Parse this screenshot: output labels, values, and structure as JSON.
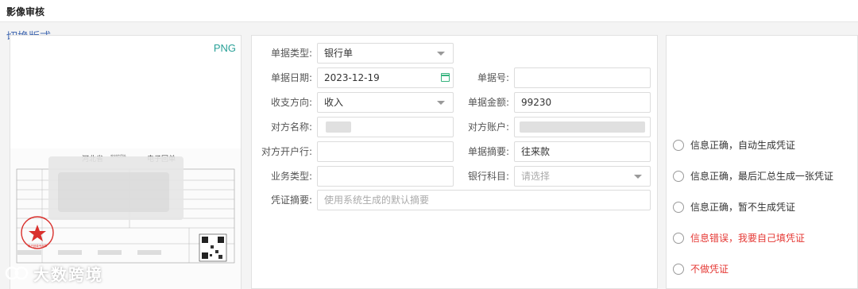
{
  "header": {
    "title": "影像审核"
  },
  "switch_label": "切换版式",
  "image_panel": {
    "format": "PNG",
    "receipt": {
      "province": "河北省",
      "bank_small": "农村信用社",
      "title": "电子回单",
      "seal_text": "电子回单专用章"
    }
  },
  "form": {
    "doc_type": {
      "label": "单据类型:",
      "value": "银行单"
    },
    "doc_date": {
      "label": "单据日期:",
      "value": "2023-12-19"
    },
    "doc_no": {
      "label": "单据号:",
      "value": ""
    },
    "direction": {
      "label": "收支方向:",
      "value": "收入"
    },
    "amount": {
      "label": "单据金额:",
      "value": "99230"
    },
    "counterparty_name": {
      "label": "对方名称:",
      "value": ""
    },
    "counterparty_account": {
      "label": "对方账户:",
      "value": ""
    },
    "counterparty_bank": {
      "label": "对方开户行:",
      "value": ""
    },
    "summary": {
      "label": "单据摘要:",
      "value": "往来款"
    },
    "business_type": {
      "label": "业务类型:",
      "value": ""
    },
    "bank_subject": {
      "label": "银行科目:",
      "placeholder": "请选择"
    },
    "voucher_summary": {
      "label": "凭证摘要:",
      "placeholder": "使用系统生成的默认摘要"
    }
  },
  "options": [
    {
      "label": "信息正确，自动生成凭证",
      "color": "#333333"
    },
    {
      "label": "信息正确，最后汇总生成一张凭证",
      "color": "#333333"
    },
    {
      "label": "信息正确，暂不生成凭证",
      "color": "#333333"
    },
    {
      "label": "信息错误，我要自己填凭证",
      "color": "#e53935"
    },
    {
      "label": "不做凭证",
      "color": "#e53935"
    }
  ],
  "watermark": "大数跨境"
}
